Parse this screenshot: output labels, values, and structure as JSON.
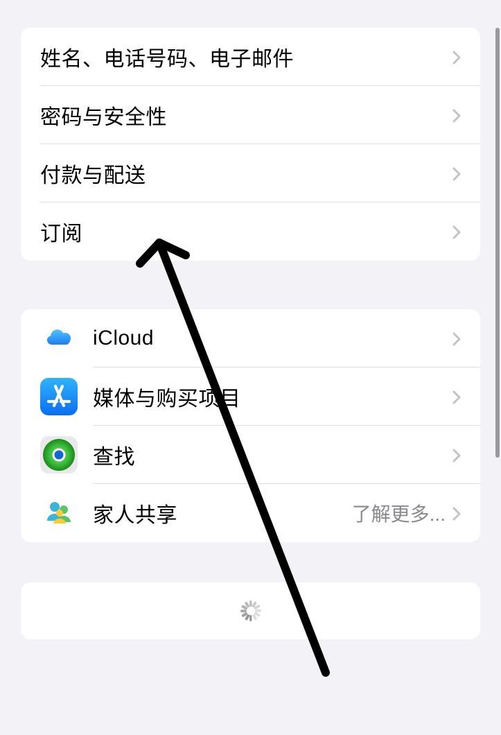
{
  "section1": {
    "items": [
      {
        "label": "姓名、电话号码、电子邮件"
      },
      {
        "label": "密码与安全性"
      },
      {
        "label": "付款与配送"
      },
      {
        "label": "订阅"
      }
    ]
  },
  "section2": {
    "items": [
      {
        "label": "iCloud",
        "icon": "icloud"
      },
      {
        "label": "媒体与购买项目",
        "icon": "appstore"
      },
      {
        "label": "查找",
        "icon": "findmy"
      },
      {
        "label": "家人共享",
        "icon": "family",
        "detail": "了解更多..."
      }
    ]
  }
}
